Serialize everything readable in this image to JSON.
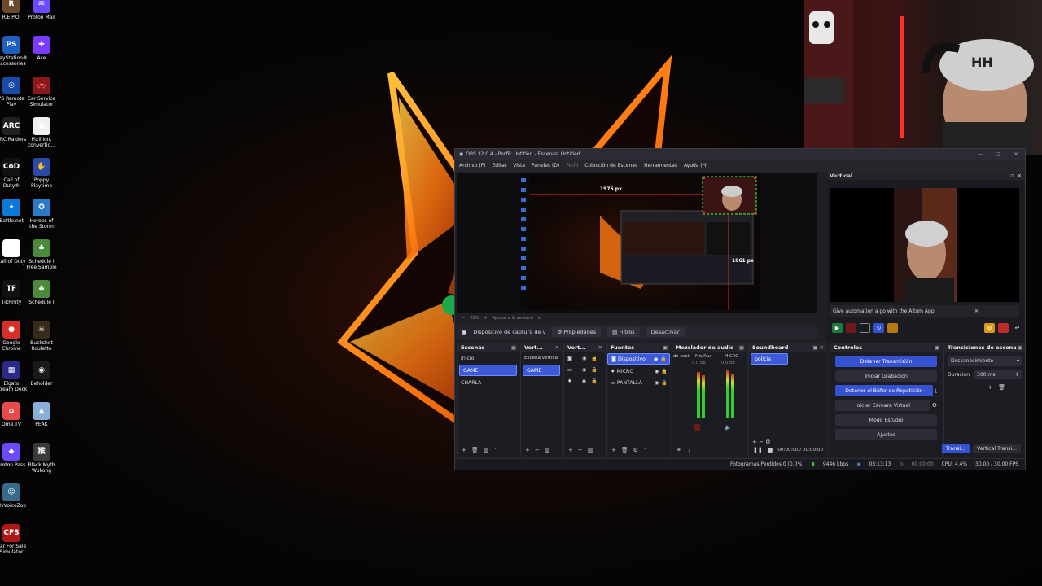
{
  "desktop": {
    "icons_col1": [
      {
        "label": "R.E.P.O.",
        "color": "#6a4a2a",
        "glyph": "R"
      },
      {
        "label": "PlayStation® Accessories",
        "color": "#1e5fc0",
        "glyph": "PS"
      },
      {
        "label": "PS Remote Play",
        "color": "#1a4aa8",
        "glyph": "◎"
      },
      {
        "label": "ARC Raiders",
        "color": "#222",
        "glyph": "ARC"
      },
      {
        "label": "Call of Duty®",
        "color": "#111",
        "glyph": "CoD"
      },
      {
        "label": "Battle.net",
        "color": "#0a7ad8",
        "glyph": "✦"
      },
      {
        "label": "Call of Duty",
        "color": "#ffffff",
        "glyph": ""
      },
      {
        "label": "TikFinity",
        "color": "#111",
        "glyph": "TF"
      },
      {
        "label": "Google Chrome",
        "color": "#d93025",
        "glyph": "●"
      },
      {
        "label": "Elgato Stream Deck",
        "color": "#2a2a8a",
        "glyph": "▦"
      },
      {
        "label": "Ome.TV",
        "color": "#e84a4a",
        "glyph": "⌂"
      },
      {
        "label": "Proton Pass",
        "color": "#6d4aff",
        "glyph": "◆"
      },
      {
        "label": "MyVoiceZoo",
        "color": "#3a6a8a",
        "glyph": "☺"
      },
      {
        "label": "Car For Sale Simulator",
        "color": "#b01818",
        "glyph": "CFS"
      }
    ],
    "icons_col2": [
      {
        "label": "Proton Mail",
        "color": "#6d4aff",
        "glyph": "✉"
      },
      {
        "label": "Ace",
        "color": "#7b3aff",
        "glyph": "✚"
      },
      {
        "label": "Car Service Simulator",
        "color": "#8a1a1a",
        "glyph": "🚗"
      },
      {
        "label": "Pixillion, convertid...",
        "color": "#f0f0f0",
        "glyph": "▣"
      },
      {
        "label": "Poppy Playtime",
        "color": "#2a4aa8",
        "glyph": "✋"
      },
      {
        "label": "Heroes of the Storm",
        "color": "#2a7ac8",
        "glyph": "✪"
      },
      {
        "label": "Schedule I Free Sample",
        "color": "#4a8a3a",
        "glyph": "♣"
      },
      {
        "label": "Schedule I",
        "color": "#4a8a3a",
        "glyph": "♣"
      },
      {
        "label": "Buckshot Roulette",
        "color": "#3a2a1a",
        "glyph": "☠"
      },
      {
        "label": "Beholder",
        "color": "#1a1a1a",
        "glyph": "◉"
      },
      {
        "label": "PEAK",
        "color": "#8ab0d8",
        "glyph": "▲"
      },
      {
        "label": "Black Myth Wukong",
        "color": "#3a3a3a",
        "glyph": "猴"
      }
    ]
  },
  "obs": {
    "title": "OBS 32.0.4 - Perfil: Untitled - Escenas: Untitled",
    "menu": [
      "Archivo (F)",
      "Editar",
      "Vista",
      "Paneles (D)",
      "Perfil",
      "Colección de Escenas",
      "Herramientas",
      "Ayuda (H)"
    ],
    "preview": {
      "label_width": "1975 px",
      "label_height": "1061 px",
      "zoom": "22%",
      "fit_label": "Ajustar a la ventana"
    },
    "source_toolbar": {
      "device": "Dispositivo de captura de v",
      "properties": "Propiedades",
      "filters": "Filtros",
      "deactivate": "Desactivar"
    },
    "vertical_panel": {
      "title": "Vertical",
      "notice": "Give automation a go with the Aitum App"
    },
    "scenes": {
      "title": "Escenas",
      "items": [
        "Inicio",
        "GAME",
        "CHARLA"
      ],
      "selected": "GAME"
    },
    "vert_scenes": {
      "title": "Vert...",
      "items": [
        "Escena vertical",
        "GAME"
      ]
    },
    "vert_sources": {
      "title": "Vert..."
    },
    "sources": {
      "title": "Fuentes",
      "items": [
        "Dispositivo",
        "MICRO",
        "PANTALLA"
      ]
    },
    "mixer": {
      "title": "Mezclador de audio",
      "channels": [
        {
          "name": "de capt",
          "db": "0.0 dB"
        },
        {
          "name": "Mic/Aux",
          "db": "0.0 dB"
        },
        {
          "name": "MICRO",
          "db": "0.0 dB"
        }
      ]
    },
    "soundboard": {
      "title": "Soundboard",
      "items": [
        "policia"
      ],
      "time": "00:00:00 / 00:00:00"
    },
    "controls": {
      "title": "Controles",
      "buttons": [
        {
          "label": "Detener Transmisión",
          "active": true
        },
        {
          "label": "Iniciar Grabación",
          "active": false
        },
        {
          "label": "Detener el Búfer de Repetición",
          "active": true
        },
        {
          "label": "Iniciar Cámara Virtual",
          "active": false
        },
        {
          "label": "Modo Estudio",
          "active": false
        },
        {
          "label": "Ajustes",
          "active": false
        }
      ]
    },
    "transitions": {
      "title": "Transiciones de escena",
      "type": "Desvanecimiento",
      "duration_label": "Duración",
      "duration": "300 ms",
      "tab_active": "Transi...",
      "tab_other": "Vertical Transi..."
    },
    "status": {
      "dropped": "Fotogramas Perdidos 0 (0.0%)",
      "bitrate": "9446 kbps",
      "stream_time": "03:13:13",
      "rec_time": "00:00:00",
      "cpu": "CPU: 4.4%",
      "fps": "30.00 / 30.00 FPS"
    }
  }
}
